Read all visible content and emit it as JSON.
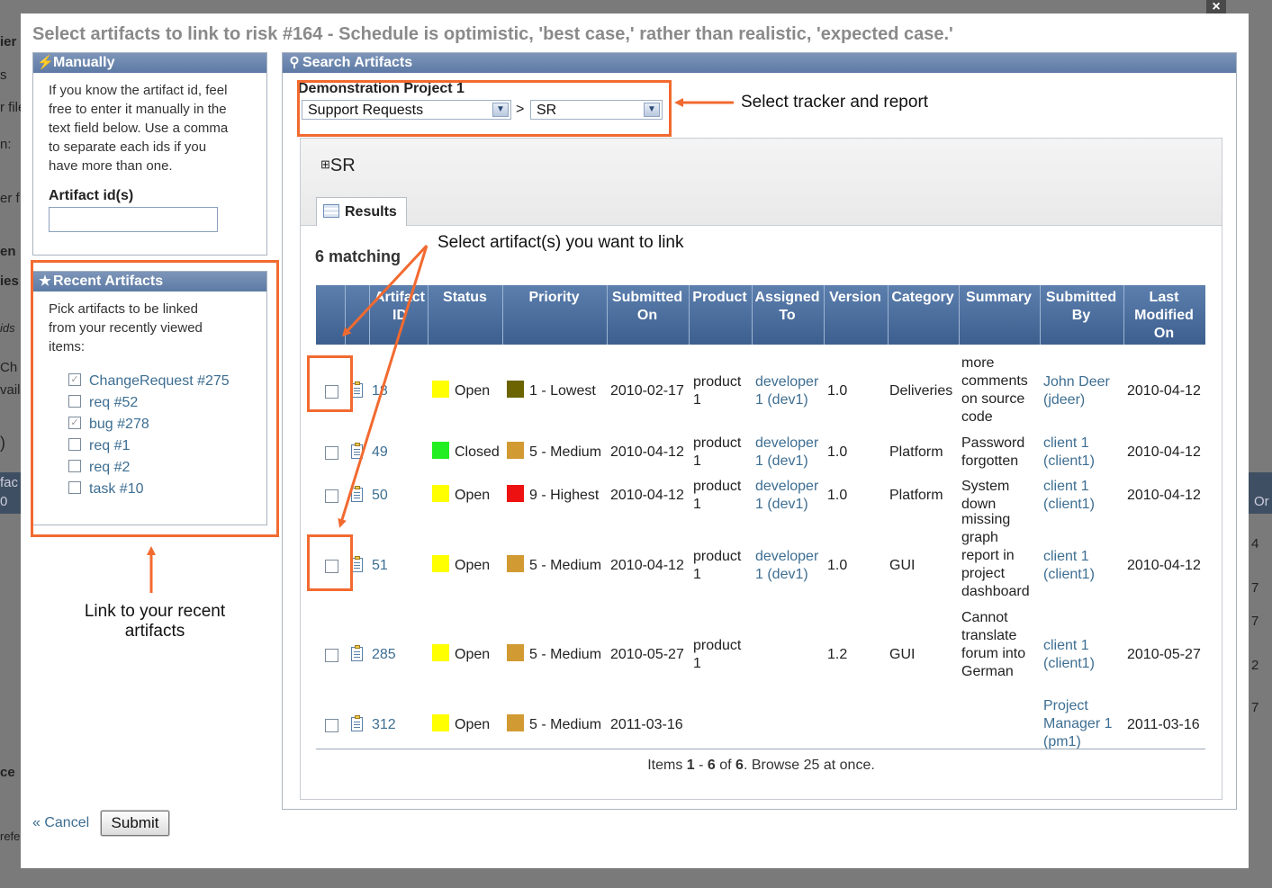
{
  "background": {
    "left_fragments": [
      "ier",
      "s",
      "r file",
      "n:",
      "er f",
      "en",
      "ies",
      "ids",
      "Ch",
      "vail",
      ")",
      "fac",
      "0",
      "ce",
      "refe"
    ],
    "right_fragments": [
      "Or",
      "4",
      "7",
      "7",
      "2",
      "7"
    ]
  },
  "dialog": {
    "close_label": "×",
    "title": "Select artifacts to link to risk #164 - Schedule is optimistic, 'best case,' rather than realistic, 'expected case.'"
  },
  "manually": {
    "header": "Manually",
    "icon": "lightning-icon",
    "text": [
      "If you know the artifact id, feel",
      "free to enter it manually in the",
      "text field below. Use a comma",
      "to separate each ids if you",
      "have more than one."
    ],
    "field_label": "Artifact id(s)",
    "field_value": ""
  },
  "recent": {
    "header": "Recent Artifacts",
    "icon": "star-icon",
    "text": [
      "Pick artifacts to be linked",
      "from your recently viewed",
      "items:"
    ],
    "items": [
      {
        "label": "ChangeRequest #275",
        "checked": true
      },
      {
        "label": "req #52",
        "checked": false
      },
      {
        "label": "bug #278",
        "checked": true
      },
      {
        "label": "req #1",
        "checked": false
      },
      {
        "label": "req #2",
        "checked": false
      },
      {
        "label": "task #10",
        "checked": false
      }
    ]
  },
  "actions": {
    "cancel_label": "« Cancel",
    "submit_label": "Submit"
  },
  "search": {
    "header": "Search Artifacts",
    "icon": "magnifier-icon",
    "project": "Demonstration Project 1",
    "tracker_value": "Support Requests",
    "separator": ">",
    "report_value": "SR",
    "report_section": "SR",
    "expand_symbol": "⊞",
    "tab_label": "Results",
    "matching": "6 matching",
    "columns": [
      "Artifact ID",
      "Status",
      "Priority",
      "Submitted On",
      "Product",
      "Assigned To",
      "Version",
      "Category",
      "Summary",
      "Submitted By",
      "Last Modified On"
    ],
    "rows": [
      {
        "id": "18",
        "status": "Open",
        "status_color": "#ffff00",
        "priority": "1 - Lowest",
        "priority_color": "#6b6400",
        "submitted_on": "2010-02-17",
        "product": [
          "product",
          "1"
        ],
        "assigned": [
          "developer",
          "1 (dev1)"
        ],
        "version": "1.0",
        "category": "Deliveries",
        "summary": [
          "more",
          "comments",
          "on source",
          "code"
        ],
        "submitted_by": [
          "John Deer",
          "(jdeer)"
        ],
        "modified": "2010-04-12"
      },
      {
        "id": "49",
        "status": "Closed",
        "status_color": "#22ee22",
        "priority": "5 - Medium",
        "priority_color": "#d19a33",
        "submitted_on": "2010-04-12",
        "product": [
          "product",
          "1"
        ],
        "assigned": [
          "developer",
          "1 (dev1)"
        ],
        "version": "1.0",
        "category": "Platform",
        "summary": [
          "Password",
          "forgotten"
        ],
        "submitted_by": [
          "client 1",
          "(client1)"
        ],
        "modified": "2010-04-12"
      },
      {
        "id": "50",
        "status": "Open",
        "status_color": "#ffff00",
        "priority": "9 - Highest",
        "priority_color": "#ee1111",
        "submitted_on": "2010-04-12",
        "product": [
          "product",
          "1"
        ],
        "assigned": [
          "developer",
          "1 (dev1)"
        ],
        "version": "1.0",
        "category": "Platform",
        "summary": [
          "System",
          "down"
        ],
        "submitted_by": [
          "client 1",
          "(client1)"
        ],
        "modified": "2010-04-12"
      },
      {
        "id": "51",
        "status": "Open",
        "status_color": "#ffff00",
        "priority": "5 - Medium",
        "priority_color": "#d19a33",
        "submitted_on": "2010-04-12",
        "product": [
          "product",
          "1"
        ],
        "assigned": [
          "developer",
          "1 (dev1)"
        ],
        "version": "1.0",
        "category": "GUI",
        "summary": [
          "missing",
          "graph",
          "report in",
          "project",
          "dashboard"
        ],
        "submitted_by": [
          "client 1",
          "(client1)"
        ],
        "modified": "2010-04-12"
      },
      {
        "id": "285",
        "status": "Open",
        "status_color": "#ffff00",
        "priority": "5 - Medium",
        "priority_color": "#d19a33",
        "submitted_on": "2010-05-27",
        "product": [
          "product",
          "1"
        ],
        "assigned": [],
        "version": "1.2",
        "category": "GUI",
        "summary": [
          "Cannot",
          "translate",
          "forum into",
          "German"
        ],
        "submitted_by": [
          "client 1",
          "(client1)"
        ],
        "modified": "2010-05-27"
      },
      {
        "id": "312",
        "status": "Open",
        "status_color": "#ffff00",
        "priority": "5 - Medium",
        "priority_color": "#d19a33",
        "submitted_on": "2011-03-16",
        "product": [],
        "assigned": [],
        "version": "",
        "category": "",
        "summary": [],
        "submitted_by": [
          "Project",
          "Manager 1",
          "(pm1)"
        ],
        "modified": "2011-03-16"
      }
    ],
    "pager": {
      "prefix": "Items ",
      "from": "1",
      "dash": " - ",
      "to": "6",
      "of": " of ",
      "total": "6",
      "suffix": ". Browse 25 at once."
    }
  },
  "annotations": {
    "tracker": "Select  tracker and report",
    "artifacts": "Select artifact(s) you want to link",
    "recent": [
      "Link to your recent",
      "artifacts"
    ],
    "accent_color": "#f26a30"
  }
}
